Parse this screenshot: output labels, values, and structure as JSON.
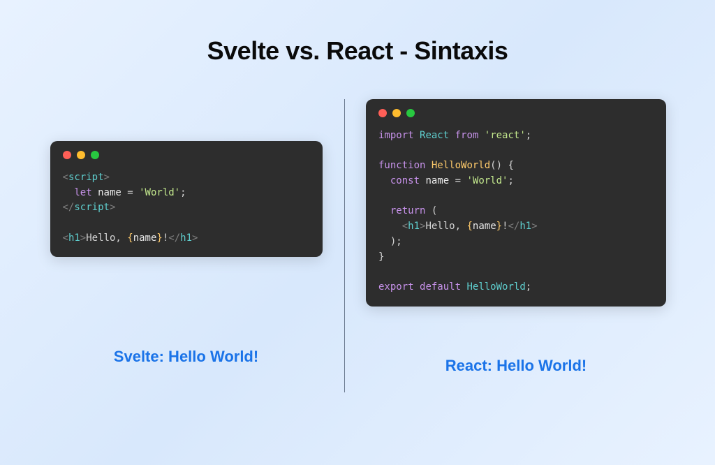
{
  "title": "Svelte vs. React - Sintaxis",
  "left": {
    "caption": "Svelte: Hello World!",
    "code": {
      "line1_open": "script",
      "line2_let": "let",
      "line2_name": "name",
      "line2_eq": " = ",
      "line2_str": "'World'",
      "line2_semi": ";",
      "line3_close": "script",
      "line5_tag": "h1",
      "line5_text1": "Hello, ",
      "line5_lbrace": "{",
      "line5_var": "name",
      "line5_rbrace": "}",
      "line5_text2": "!"
    }
  },
  "right": {
    "caption": "React: Hello World!",
    "code": {
      "l1_import": "import",
      "l1_react": "React",
      "l1_from": "from",
      "l1_str": "'react'",
      "l1_semi": ";",
      "l3_function": "function",
      "l3_name": "HelloWorld",
      "l3_paren": "() {",
      "l4_const": "const",
      "l4_name": "name",
      "l4_eq": " = ",
      "l4_str": "'World'",
      "l4_semi": ";",
      "l6_return": "return",
      "l6_open": " (",
      "l7_tag": "h1",
      "l7_text1": "Hello, ",
      "l7_lbrace": "{",
      "l7_var": "name",
      "l7_rbrace": "}",
      "l7_text2": "!",
      "l8_close": ");",
      "l9_close": "}",
      "l11_export": "export",
      "l11_default": "default",
      "l11_name": "HelloWorld",
      "l11_semi": ";"
    }
  }
}
